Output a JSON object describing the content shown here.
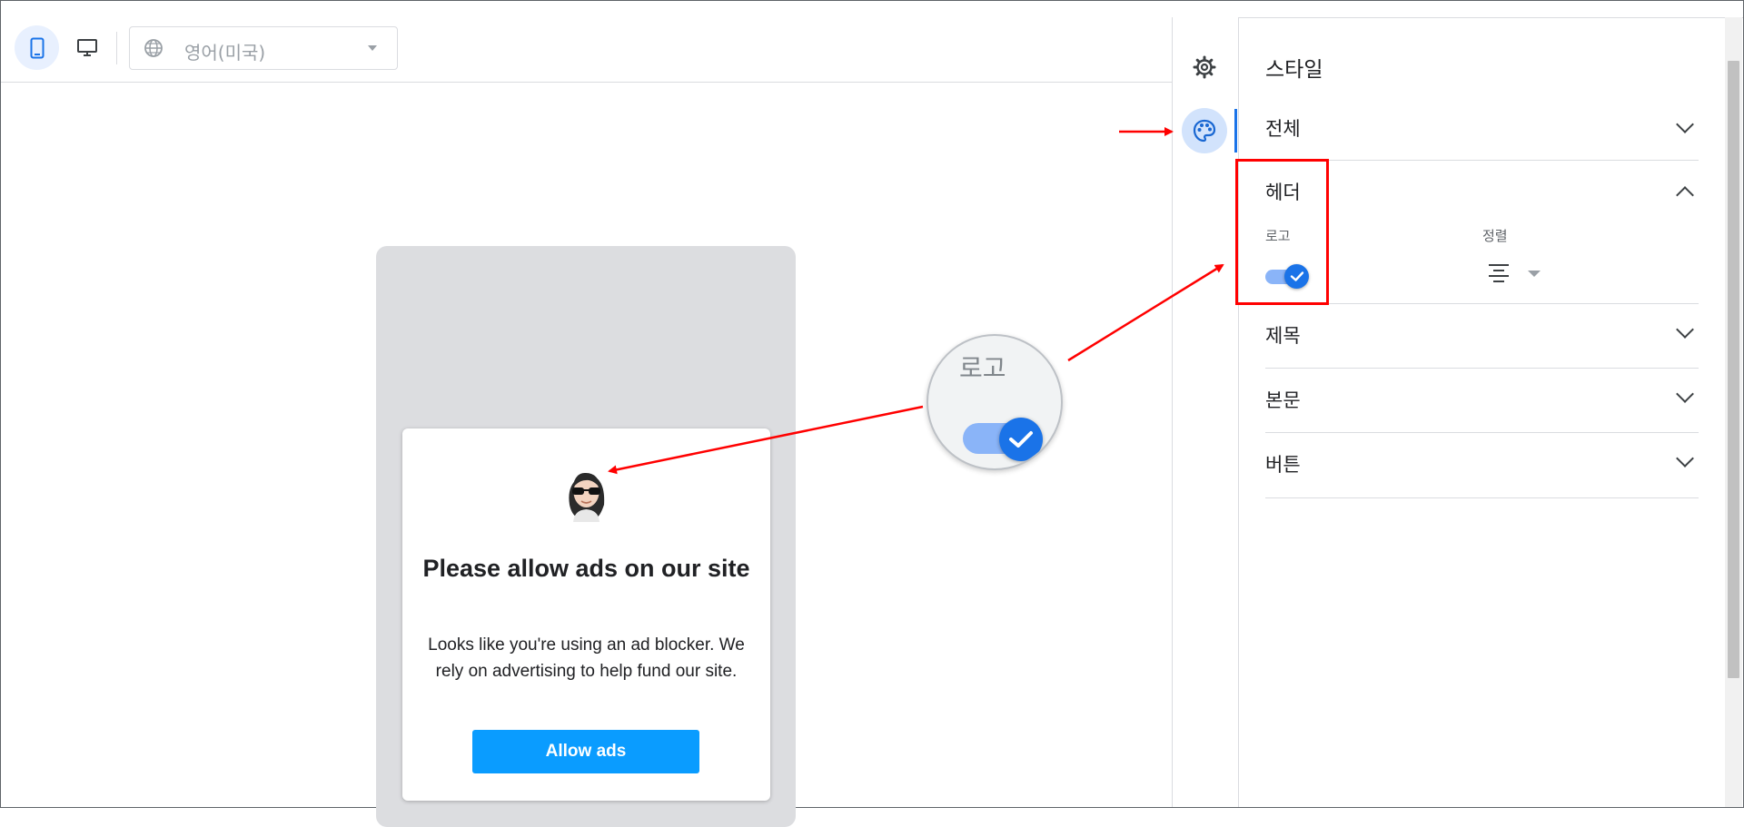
{
  "toolbar": {
    "device_mobile_icon": "phone-icon",
    "device_desktop_icon": "monitor-icon",
    "language": {
      "icon": "globe-icon",
      "value": "영어(미국)"
    }
  },
  "preview": {
    "dialog": {
      "logo_icon": "avatar-sunglasses",
      "title": "Please allow ads on our site",
      "body": "Looks like you're using an ad blocker. We rely on advertising to help fund our site.",
      "button_label": "Allow ads"
    }
  },
  "magnifier": {
    "label": "로고",
    "toggle_on": true
  },
  "rail": {
    "items": [
      {
        "icon": "gear-icon",
        "active": false
      },
      {
        "icon": "palette-icon",
        "active": true
      }
    ]
  },
  "panel": {
    "title": "스타일",
    "sections": [
      {
        "label": "전체",
        "expanded": false
      },
      {
        "label": "헤더",
        "expanded": true,
        "fields": {
          "logo_label": "로고",
          "logo_enabled": true,
          "alignment_label": "정렬",
          "alignment_value": "center-align-icon"
        }
      },
      {
        "label": "제목",
        "expanded": false
      },
      {
        "label": "본문",
        "expanded": false
      },
      {
        "label": "버튼",
        "expanded": false
      }
    ]
  },
  "colors": {
    "accent": "#1a73e8",
    "toggle_track": "#8ab4f8",
    "allow_button": "#0a9cff",
    "annotation": "#ff0000"
  }
}
